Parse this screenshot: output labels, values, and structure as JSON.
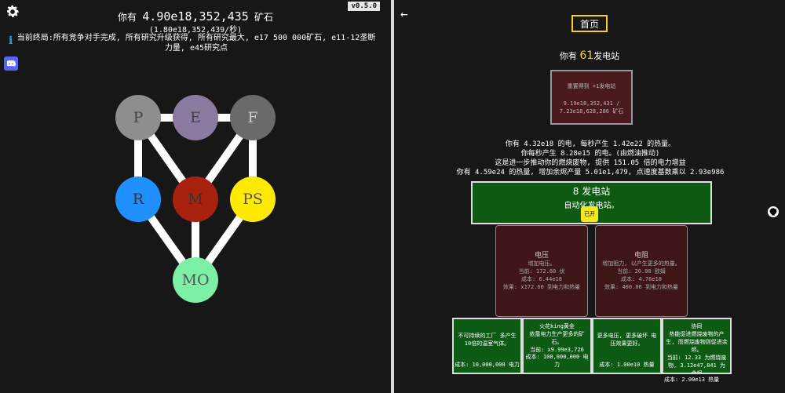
{
  "left": {
    "version": "v0.5.0",
    "ore_prefix": "你有",
    "ore_value": "4.90e18,352,435",
    "ore_suffix": "矿石",
    "ore_rate": "(1.80e18,352,439/秒)",
    "endgame": "当前终局:所有竞争对手完成, 所有研究升级获得, 所有研究最大, e17 500 000矿石, e11-12垄断力量, e45研究点",
    "info_label": "i",
    "nodes": [
      {
        "id": "P",
        "label": "P",
        "color": "#8e8e8e"
      },
      {
        "id": "E",
        "label": "E",
        "color": "#8a7aa0"
      },
      {
        "id": "F",
        "label": "F",
        "color": "#6a6a6a"
      },
      {
        "id": "R",
        "label": "R",
        "color": "#1e90ff"
      },
      {
        "id": "M",
        "label": "M",
        "color": "#a8200e"
      },
      {
        "id": "PS",
        "label": "PS",
        "color": "#ffea00"
      },
      {
        "id": "MO",
        "label": "MO",
        "color": "#7df0a8"
      }
    ]
  },
  "right": {
    "home_label": "首页",
    "stations_prefix": "你有",
    "stations_count": "61",
    "stations_suffix": "发电站",
    "reset_title": "重置得到 +1发电站",
    "reset_cost": "9.19e18,352,431 / 7.23e18,628,286 矿石",
    "stats": [
      "你有 4.32e18 的电, 每秒产生 1.42e22 的热量。",
      "你每秒产生 8.28e15 的电。(由燃油推动)",
      "这是进一步推动你的燃烧废物, 提供 151.05 倍的电力增益",
      "你有 4.59e24 的热量, 增加余烬产量 5.01e1,479, 点速度基数乘以 2.93e986"
    ],
    "auto": {
      "title": "8 发电站",
      "desc": "自动化发电站。",
      "toggle": "已开"
    },
    "upgrades": [
      {
        "title": "电压",
        "desc": "增加电压。",
        "current": "当前: 172.60 伏",
        "cost": "成本: 6.44e18",
        "effect": "效果: x172.60 到电力和热量"
      },
      {
        "title": "电阻",
        "desc": "增加阻力, 以产生更多的热量。",
        "current": "当前: 20.00 欧姆",
        "cost": "成本: 4.76e18",
        "effect": "效果: 400.00 到电力和热量"
      }
    ],
    "generators": [
      {
        "title": "",
        "desc": "不可持续的工厂 多产生10倍的温室气体。",
        "current": "",
        "cost": "成本: 10,000,000 电力"
      },
      {
        "title": "火花king黄金",
        "desc": "依靠电力生产更多的矿石。",
        "current": "当前: x9.99e3,726",
        "cost": "成本: 100,000,000 电力"
      },
      {
        "title": "",
        "desc": "更多电压, 更多破坏 电压效果更好。",
        "current": "",
        "cost": "成本: 1.00e10 热量"
      },
      {
        "title": "协同",
        "desc": "热能促进燃烧废物的产生, 而燃烧废物则促进余烬。",
        "current": "当前: 12.33 为燃烧废物, 3.12e47,841 为余烬",
        "cost": ""
      }
    ],
    "final_cost": "成本: 2.00e13 热量"
  }
}
